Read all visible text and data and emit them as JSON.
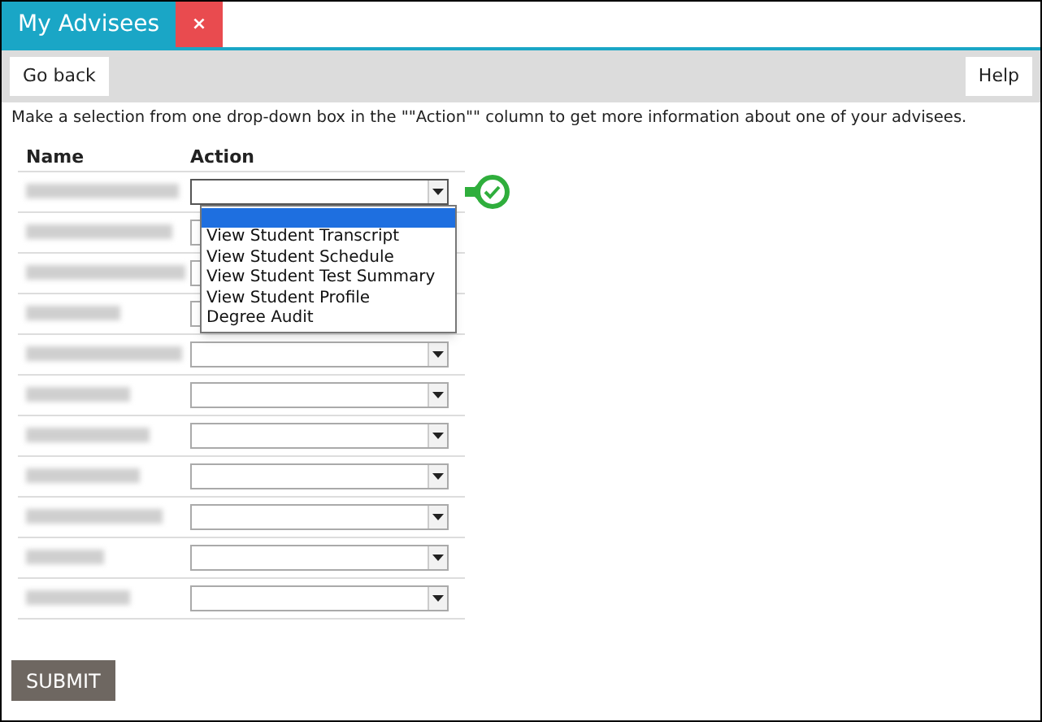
{
  "tabs": [
    {
      "label": "My Advisees",
      "selected": true,
      "close": "×"
    }
  ],
  "toolbar": {
    "back": "Go back",
    "help": "Help"
  },
  "instruction": "Make a selection from one drop-down box in the \"\"Action\"\" column to get more information about one of your advisees.",
  "table": {
    "columns": [
      "Name",
      "Action"
    ],
    "rows": [
      {
        "expanded": true,
        "checked": true,
        "options": [
          {
            "selected": true
          },
          {
            "label": "View Student Transcript",
            "selected": false
          },
          {
            "label": "View Student Schedule",
            "selected": false
          },
          {
            "label": "View Student Test Summary",
            "selected": false
          },
          {
            "label": "View Student Profile",
            "selected": false
          },
          {
            "label": "Degree Audit",
            "selected": false
          }
        ]
      },
      {
        "expanded": false,
        "checked": false
      },
      {
        "expanded": false,
        "checked": false
      },
      {
        "expanded": false,
        "checked": false
      },
      {
        "expanded": false,
        "checked": false
      },
      {
        "expanded": false,
        "checked": false
      },
      {
        "expanded": false,
        "checked": false
      },
      {
        "expanded": false,
        "checked": false
      },
      {
        "expanded": false,
        "checked": false
      },
      {
        "expanded": false,
        "checked": false
      },
      {
        "expanded": false,
        "checked": false
      }
    ]
  },
  "submit": "SUBMIT"
}
